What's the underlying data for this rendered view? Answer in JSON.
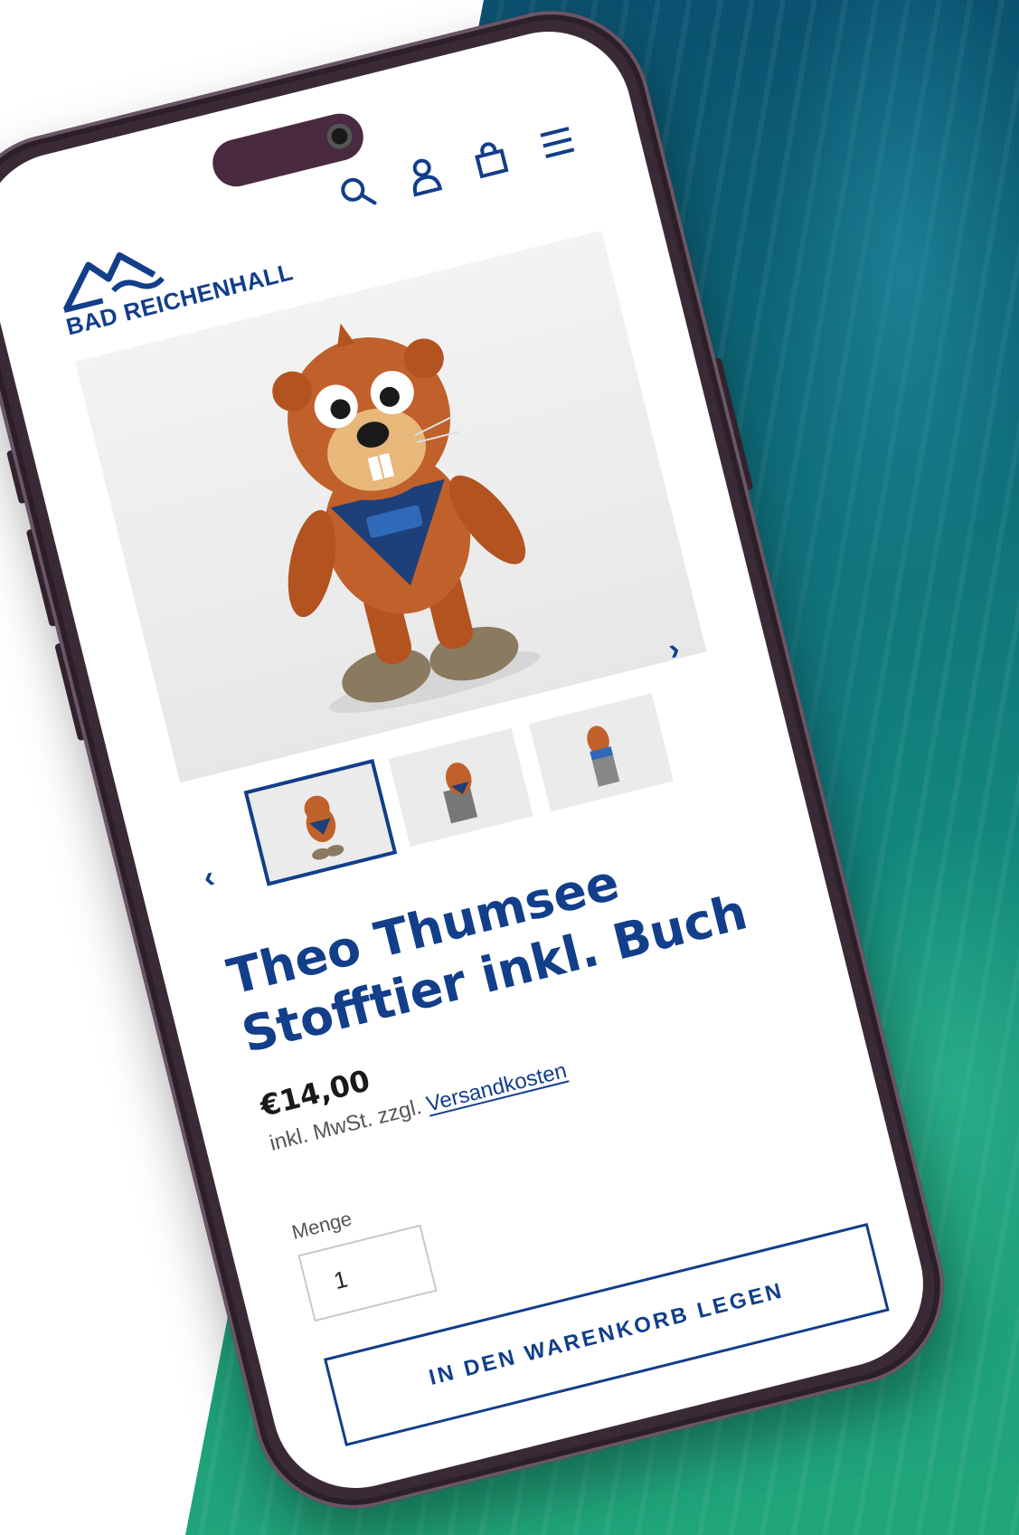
{
  "brand": {
    "name": "BAD REICHENHALL",
    "color": "#123e8a"
  },
  "header": {
    "icons": [
      "search-icon",
      "account-icon",
      "cart-icon",
      "menu-icon"
    ]
  },
  "gallery": {
    "thumbnails": [
      "thumbnail-1",
      "thumbnail-2",
      "thumbnail-3"
    ],
    "active_index": 0,
    "prev_glyph": "‹",
    "next_glyph": "›"
  },
  "product": {
    "title": "Theo Thumsee Stofftier inkl. Buch",
    "price": "€14,00",
    "tax_prefix": "inkl. MwSt. zzgl.",
    "shipping_link": "Versandkosten",
    "quantity_label": "Menge",
    "quantity_value": "1",
    "add_to_cart": "IN DEN WARENKORB LEGEN"
  }
}
